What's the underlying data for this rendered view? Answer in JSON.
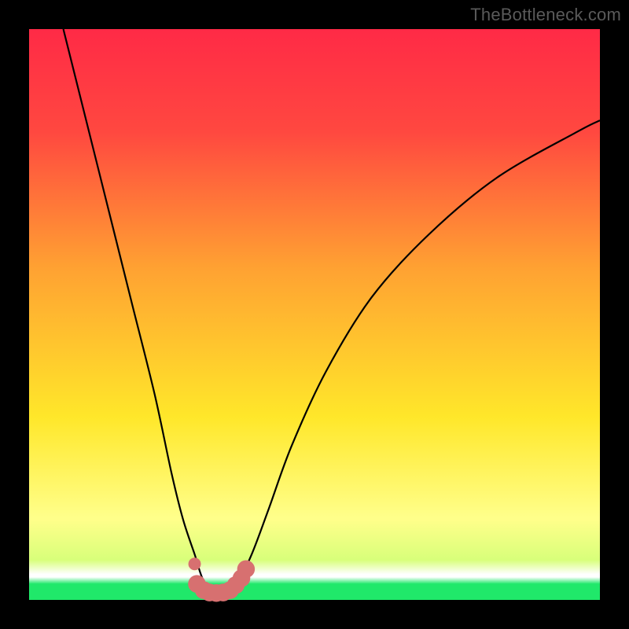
{
  "watermark": "TheBottleneck.com",
  "colors": {
    "top": "#ff2a46",
    "upper": "#ff4840",
    "orange": "#ffa232",
    "yellow": "#ffe72a",
    "lightyellow": "#ffff8a",
    "white": "#ffffff",
    "green": "#20e86a",
    "curve": "#000000",
    "dotStroke": "#d77070",
    "dotFill": "#d77070"
  },
  "chart_data": {
    "type": "line",
    "title": "",
    "xlabel": "",
    "ylabel": "",
    "xlim": [
      0,
      100
    ],
    "ylim": [
      0,
      100
    ],
    "series": [
      {
        "name": "bottleneck-curve",
        "x": [
          6,
          10,
          14,
          18,
          22,
          25,
          27,
          29,
          30.5,
          32.5,
          34.5,
          36.5,
          39,
          42,
          46,
          52,
          60,
          70,
          82,
          96,
          100
        ],
        "y": [
          100,
          84,
          68,
          52,
          36,
          22,
          14,
          8,
          3.5,
          1.5,
          1.2,
          3.0,
          8,
          16,
          27,
          40,
          53,
          64,
          74,
          82,
          84
        ]
      }
    ],
    "markers": {
      "name": "highlight-dots",
      "x": [
        29.4,
        30.6,
        31.6,
        32.8,
        34.0,
        35.2,
        36.2,
        37.2,
        38.0,
        29.0
      ],
      "y": [
        2.8,
        1.7,
        1.3,
        1.2,
        1.3,
        1.7,
        2.6,
        3.8,
        5.4,
        6.3
      ],
      "r": 1.55,
      "r_outlier": 1.1
    }
  }
}
